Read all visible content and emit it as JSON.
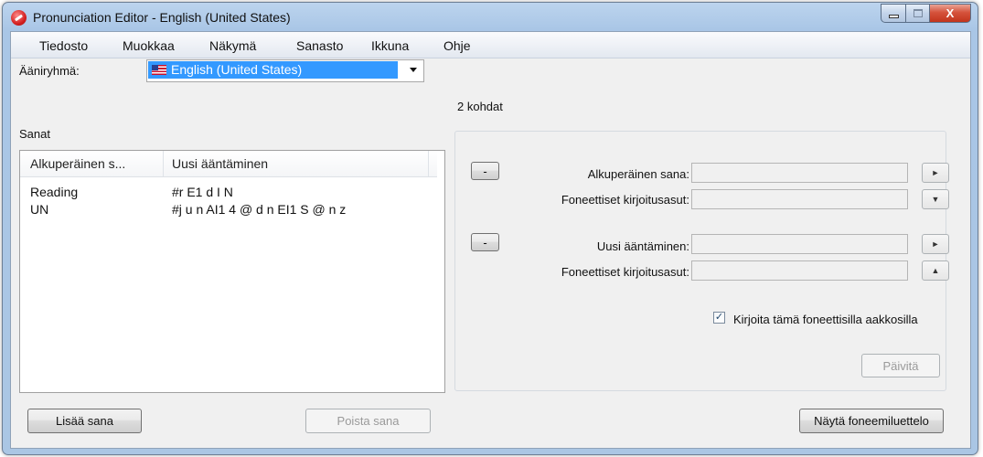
{
  "window": {
    "title": "Pronunciation Editor - English (United States)",
    "close_glyph": "X"
  },
  "menu": [
    {
      "label": "Tiedosto"
    },
    {
      "label": "Muokkaa"
    },
    {
      "label": "Näkymä"
    },
    {
      "label": "Sanasto"
    },
    {
      "label": "Ikkuna"
    },
    {
      "label": "Ohje"
    }
  ],
  "voice_group": {
    "label": "Ääniryhmä:",
    "selected": "English (United States)",
    "flag_icon": "us-flag-icon"
  },
  "count_text": "2 kohdat",
  "words": {
    "label": "Sanat",
    "columns": [
      "Alkuperäinen s...",
      "Uusi ääntäminen"
    ],
    "rows": [
      {
        "original": "Reading",
        "pronunciation": "#r E1 d I N"
      },
      {
        "original": "UN",
        "pronunciation": "#j u n AI1 4 @ d n EI1 S @ n z"
      }
    ]
  },
  "editor": {
    "minus_label": "-",
    "original_word_label": "Alkuperäinen sana:",
    "phonetic_label_1": "Foneettiset kirjoitusasut:",
    "new_pronunciation_label": "Uusi ääntäminen:",
    "phonetic_label_2": "Foneettiset kirjoitusasut:",
    "play_glyph": "►",
    "down_glyph": "▼",
    "up_glyph": "▲",
    "checkbox_label": "Kirjoita tämä foneettisilla aakkosilla",
    "checkbox_checked": true,
    "checkbox_mark": "✓",
    "update_button": "Päivitä"
  },
  "buttons": {
    "add_word": "Lisää sana",
    "remove_word": "Poista sana",
    "show_phoneme_list": "Näytä foneemiluettelo"
  }
}
